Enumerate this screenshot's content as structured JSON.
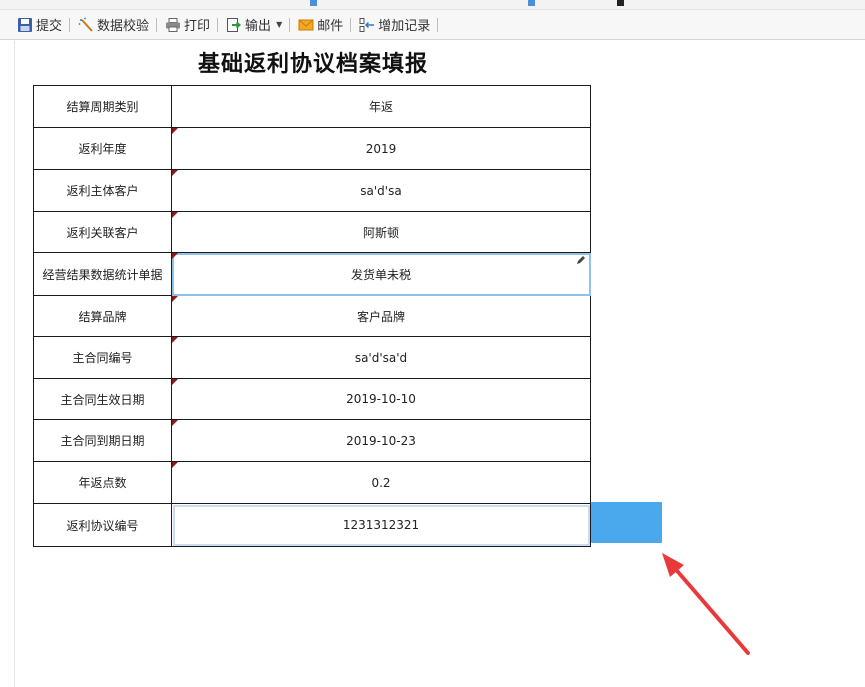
{
  "toolbar": {
    "submit": "提交",
    "validate": "数据校验",
    "print": "打印",
    "export": "输出",
    "mail": "邮件",
    "add_record": "增加记录"
  },
  "form": {
    "title": "基础返利协议档案填报",
    "rows": [
      {
        "label": "结算周期类别",
        "value": "年返"
      },
      {
        "label": "返利年度",
        "value": "2019"
      },
      {
        "label": "返利主体客户",
        "value": "sa'd'sa"
      },
      {
        "label": "返利关联客户",
        "value": "阿斯顿"
      },
      {
        "label": "经营结果数据统计单据",
        "value": "发货单未税"
      },
      {
        "label": "结算品牌",
        "value": "客户品牌"
      },
      {
        "label": "主合同编号",
        "value": "sa'd'sa'd"
      },
      {
        "label": "主合同生效日期",
        "value": "2019-10-10"
      },
      {
        "label": "主合同到期日期",
        "value": "2019-10-23"
      },
      {
        "label": "年返点数",
        "value": "0.2"
      },
      {
        "label": "返利协议编号",
        "value": "1231312321"
      }
    ]
  },
  "colors": {
    "action_button": "#4aa9ed",
    "annotation_arrow": "#e83a3a",
    "cell_marker": "#8b1c1c"
  }
}
